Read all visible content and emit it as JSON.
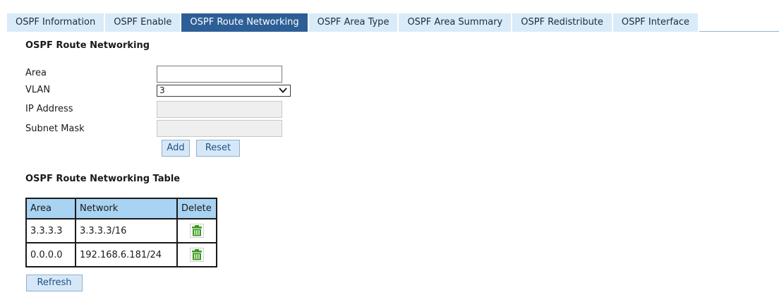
{
  "tabs": [
    {
      "label": "OSPF Information",
      "active": false
    },
    {
      "label": "OSPF Enable",
      "active": false
    },
    {
      "label": "OSPF Route Networking",
      "active": true
    },
    {
      "label": "OSPF Area Type",
      "active": false
    },
    {
      "label": "OSPF Area Summary",
      "active": false
    },
    {
      "label": "OSPF Redistribute",
      "active": false
    },
    {
      "label": "OSPF Interface",
      "active": false
    }
  ],
  "form": {
    "title": "OSPF Route Networking",
    "area_label": "Area",
    "area_value": "",
    "vlan_label": "VLAN",
    "vlan_value": "3",
    "ip_label": "IP Address",
    "ip_value": "",
    "mask_label": "Subnet Mask",
    "mask_value": "",
    "add_label": "Add",
    "reset_label": "Reset"
  },
  "table": {
    "title": "OSPF Route Networking Table",
    "headers": [
      "Area",
      "Network",
      "Delete"
    ],
    "rows": [
      {
        "area": "3.3.3.3",
        "network": "3.3.3.3/16"
      },
      {
        "area": "0.0.0.0",
        "network": "192.168.6.181/24"
      }
    ],
    "refresh_label": "Refresh"
  },
  "colors": {
    "tab_active": "#2d5f96",
    "tab_inactive": "#d9ebf8",
    "table_header": "#a9d3f2",
    "button_bg": "#d6e8f7",
    "trash_icon": "#3a9a1c"
  }
}
